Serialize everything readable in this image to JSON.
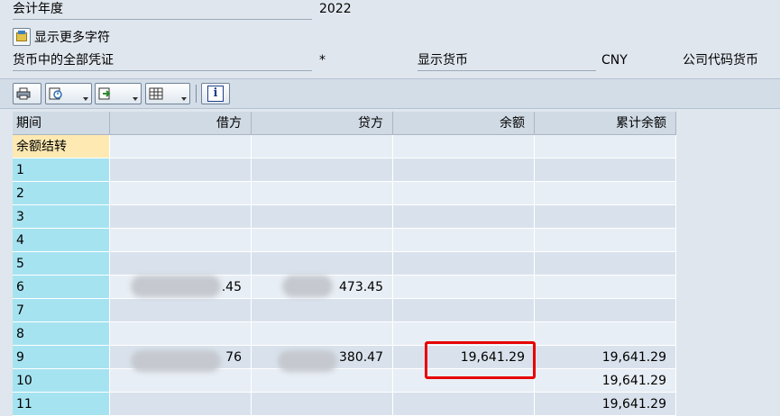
{
  "fields": {
    "fiscal_year_label": "会计年度",
    "fiscal_year_value": "2022",
    "show_more_label": "显示更多字符",
    "all_docs_label": "货币中的全部凭证",
    "all_docs_value": "*",
    "display_currency_label": "显示货币",
    "display_currency_value": "CNY",
    "company_code_currency_label": "公司代码货币"
  },
  "toolbar": {
    "icons": [
      "print-icon",
      "details-icon",
      "export-icon",
      "layout-icon",
      "info-icon"
    ],
    "info_glyph": "i"
  },
  "table": {
    "headers": [
      "期间",
      "借方",
      "贷方",
      "余额",
      "累计余额"
    ],
    "rows": [
      [
        "余额结转",
        "",
        "",
        "",
        ""
      ],
      [
        "1",
        "",
        "",
        "",
        ""
      ],
      [
        "2",
        "",
        "",
        "",
        ""
      ],
      [
        "3",
        "",
        "",
        "",
        ""
      ],
      [
        "4",
        "",
        "",
        "",
        ""
      ],
      [
        "5",
        "",
        "",
        "",
        ""
      ],
      [
        "6",
        ".45",
        "473.45",
        "",
        ""
      ],
      [
        "7",
        "",
        "",
        "",
        ""
      ],
      [
        "8",
        "",
        "",
        "",
        ""
      ],
      [
        "9",
        "76",
        "380.47",
        "19,641.29",
        "19,641.29"
      ],
      [
        "10",
        "",
        "",
        "",
        "19,641.29"
      ],
      [
        "11",
        "",
        "",
        "",
        "19,641.29"
      ]
    ]
  },
  "colors": {
    "period_col": "#a6e3f1",
    "balance_carry_row": "#fde9b1",
    "row_even": "#e8eef5",
    "row_odd": "#d9e2ec",
    "highlight_border": "#e60000"
  }
}
